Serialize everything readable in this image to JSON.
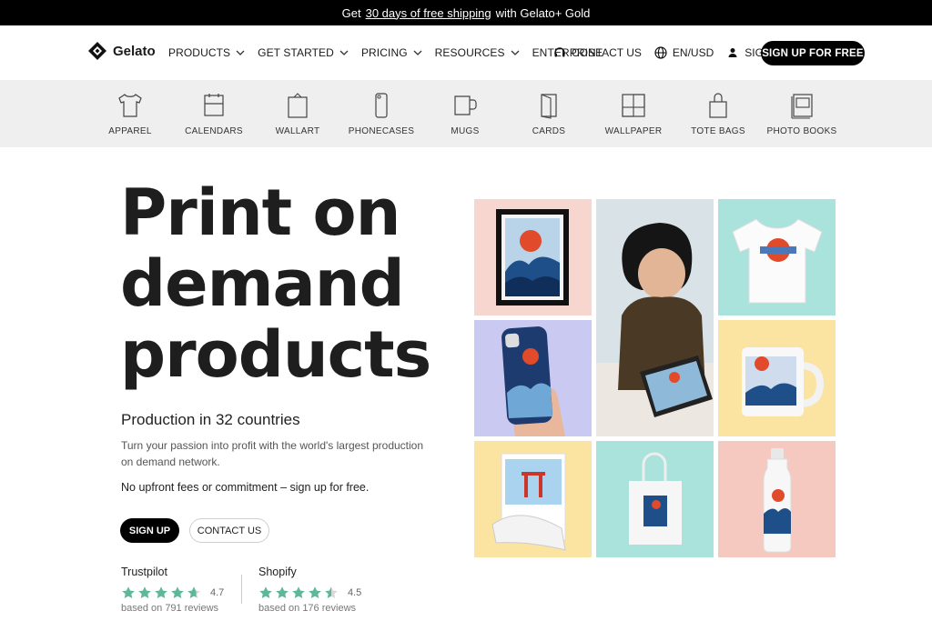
{
  "promo": {
    "prefix": "Get",
    "link": "30 days of free shipping",
    "suffix": "with Gelato+ Gold"
  },
  "nav": {
    "logo": "Gelato",
    "menu": [
      "PRODUCTS",
      "GET STARTED",
      "PRICING",
      "RESOURCES",
      "ENTERPRISE"
    ],
    "contact": "CONTACT US",
    "locale": "EN/USD",
    "signin": "SIGN IN",
    "signup": "SIGN UP FOR FREE"
  },
  "categories": [
    "APPAREL",
    "CALENDARS",
    "WALLART",
    "PHONECASES",
    "MUGS",
    "CARDS",
    "WALLPAPER",
    "TOTE BAGS",
    "PHOTO BOOKS"
  ],
  "hero": {
    "title_lines": [
      "Print on",
      "demand",
      "products"
    ],
    "subtitle": "Production in 32 countries",
    "description": "Turn your passion into profit with the world's largest production on demand network.",
    "nofee": "No upfront fees or commitment – sign up for free.",
    "signup_label": "SIGN UP",
    "contact_label": "CONTACT US"
  },
  "ratings": [
    {
      "source": "Trustpilot",
      "score": "4.7",
      "reviews": "based on 791 reviews",
      "stars_value": 4.7
    },
    {
      "source": "Shopify",
      "score": "4.5",
      "reviews": "based on 176 reviews",
      "stars_value": 4.5
    }
  ],
  "colors": {
    "star": "#5fb79a",
    "tile_pink": "#f7d6cf",
    "tile_mint": "#a9e3dc",
    "tile_lavender": "#c9c9f1",
    "tile_yellow": "#fbe3a2",
    "tile_peach": "#f6c9c0"
  }
}
